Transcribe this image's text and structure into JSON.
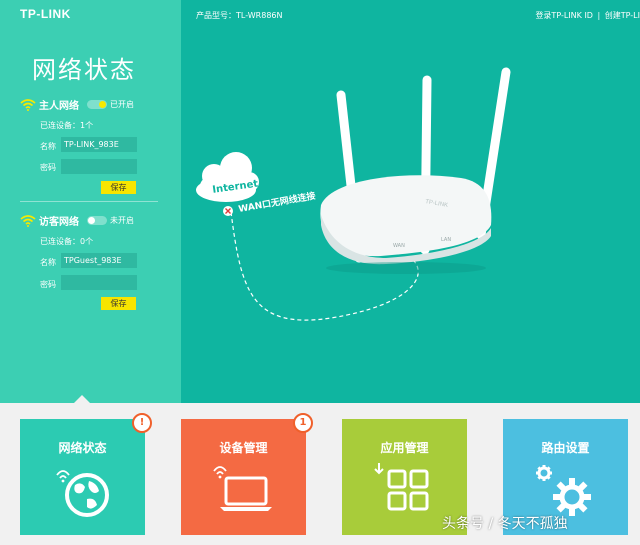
{
  "topbar": {
    "logo": "TP-LINK",
    "model_label": "产品型号：TL-WR886N",
    "login_link": "登录TP-LINK ID",
    "create_link": "创建TP-LI"
  },
  "left_panel": {
    "title": "网络状态",
    "main_wifi": {
      "title": "主人网络",
      "toggle_label": "已开启",
      "connected": "已连设备：1个",
      "name_label": "名称",
      "name_value": "TP-LINK_983E",
      "password_label": "密码",
      "password_value": "",
      "save": "保存"
    },
    "guest_wifi": {
      "title": "访客网络",
      "toggle_label": "未开启",
      "connected": "已连设备：0个",
      "name_label": "名称",
      "name_value": "TPGuest_983E",
      "password_label": "密码",
      "password_value": "",
      "save": "保存"
    }
  },
  "diagram": {
    "cloud_label": "Internet",
    "status_text": "WAN口无网线连接",
    "router_brand": "TP-LINK",
    "port_wan": "WAN",
    "port_lan": "LAN"
  },
  "tiles": [
    {
      "label": "网络状态",
      "color": "#2ccbb2",
      "badge": "!"
    },
    {
      "label": "设备管理",
      "color": "#f46a43",
      "badge": "1"
    },
    {
      "label": "应用管理",
      "color": "#a8cc3a",
      "badge": ""
    },
    {
      "label": "路由设置",
      "color": "#4cbfe0",
      "badge": ""
    }
  ],
  "watermark": "头条号 / 冬天不孤独",
  "colors": {
    "left_panel": "#3ccfb3",
    "main_panel": "#0fb5a0",
    "accent_yellow": "#f7e500",
    "alert_orange": "#f0602b"
  }
}
